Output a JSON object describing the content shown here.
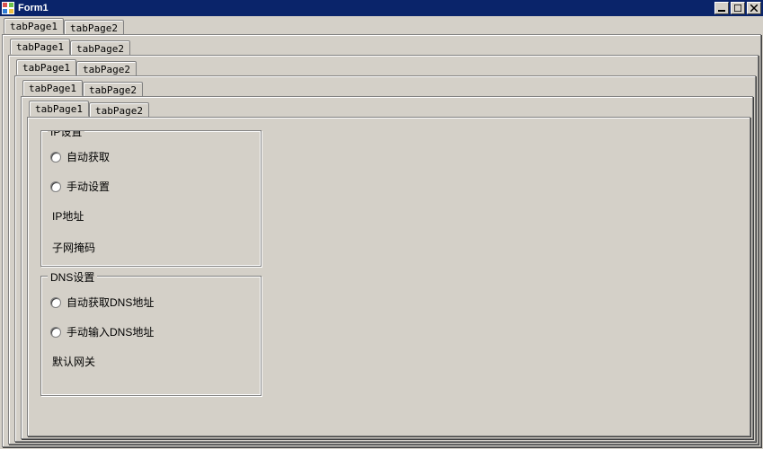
{
  "window": {
    "title": "Form1"
  },
  "tabs": {
    "page1": "tabPage1",
    "page2": "tabPage2"
  },
  "ip_group": {
    "legend": "IP设置",
    "auto": "自动获取",
    "manual": "手动设置",
    "ip_label": "IP地址",
    "subnet_partial": "子网掩码"
  },
  "dns_group": {
    "legend": "DNS设置",
    "auto": "自动获取DNS地址",
    "manual": "手动输入DNS地址",
    "gateway": "默认网关"
  }
}
